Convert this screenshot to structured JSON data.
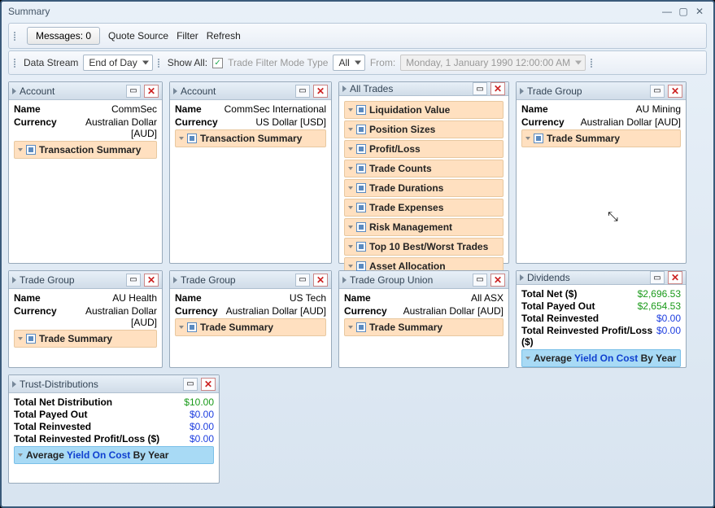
{
  "window": {
    "title": "Summary"
  },
  "toolbar": {
    "messages_label": "Messages: 0",
    "quote_source": "Quote Source",
    "filter": "Filter",
    "refresh": "Refresh"
  },
  "toolbar2": {
    "data_stream_label": "Data Stream",
    "data_stream_value": "End of Day",
    "show_all_label": "Show All:",
    "trade_filter_label": "Trade Filter Mode Type",
    "trade_filter_value": "All",
    "from_label": "From:",
    "from_value": "Monday, 1 January 1990 12:00:00 AM"
  },
  "labels": {
    "name": "Name",
    "currency": "Currency",
    "transaction_summary": "Transaction Summary",
    "trade_summary": "Trade Summary",
    "avg_yoc_prefix": "Average ",
    "avg_yoc_mid": "Yield On Cost",
    "avg_yoc_suffix": " By Year"
  },
  "panels": {
    "account1": {
      "title": "Account",
      "name": "CommSec",
      "currency": "Australian Dollar [AUD]"
    },
    "account2": {
      "title": "Account",
      "name": "CommSec International",
      "currency": "US Dollar [USD]"
    },
    "alltrades": {
      "title": "All Trades",
      "items": [
        "Liquidation Value",
        "Position Sizes",
        "Profit/Loss",
        "Trade Counts",
        "Trade Durations",
        "Trade Expenses",
        "Risk Management",
        "Top 10 Best/Worst Trades",
        "Asset Allocation"
      ]
    },
    "tg1": {
      "title": "Trade Group",
      "name": "AU Mining",
      "currency": "Australian Dollar [AUD]"
    },
    "tg2": {
      "title": "Trade Group",
      "name": "AU Health",
      "currency": "Australian Dollar [AUD]"
    },
    "tg3": {
      "title": "Trade Group",
      "name": "US Tech",
      "currency": "Australian Dollar [AUD]"
    },
    "tgu": {
      "title": "Trade Group Union",
      "name": "All ASX",
      "currency": "Australian Dollar [AUD]"
    },
    "dividends": {
      "title": "Dividends",
      "rows": [
        {
          "k": "Total Net ($)",
          "v": "$2,696.53",
          "cls": "green"
        },
        {
          "k": "Total Payed Out",
          "v": "$2,654.53",
          "cls": "green"
        },
        {
          "k": "Total Reinvested",
          "v": "$0.00",
          "cls": "blue"
        },
        {
          "k": "Total Reinvested Profit/Loss ($)",
          "v": "$0.00",
          "cls": "blue"
        }
      ]
    },
    "trust": {
      "title": "Trust-Distributions",
      "rows": [
        {
          "k": "Total Net Distribution",
          "v": "$10.00",
          "cls": "green"
        },
        {
          "k": "Total Payed Out",
          "v": "$0.00",
          "cls": "blue"
        },
        {
          "k": "Total Reinvested",
          "v": "$0.00",
          "cls": "blue"
        },
        {
          "k": "Total Reinvested Profit/Loss ($)",
          "v": "$0.00",
          "cls": "blue"
        }
      ]
    }
  }
}
